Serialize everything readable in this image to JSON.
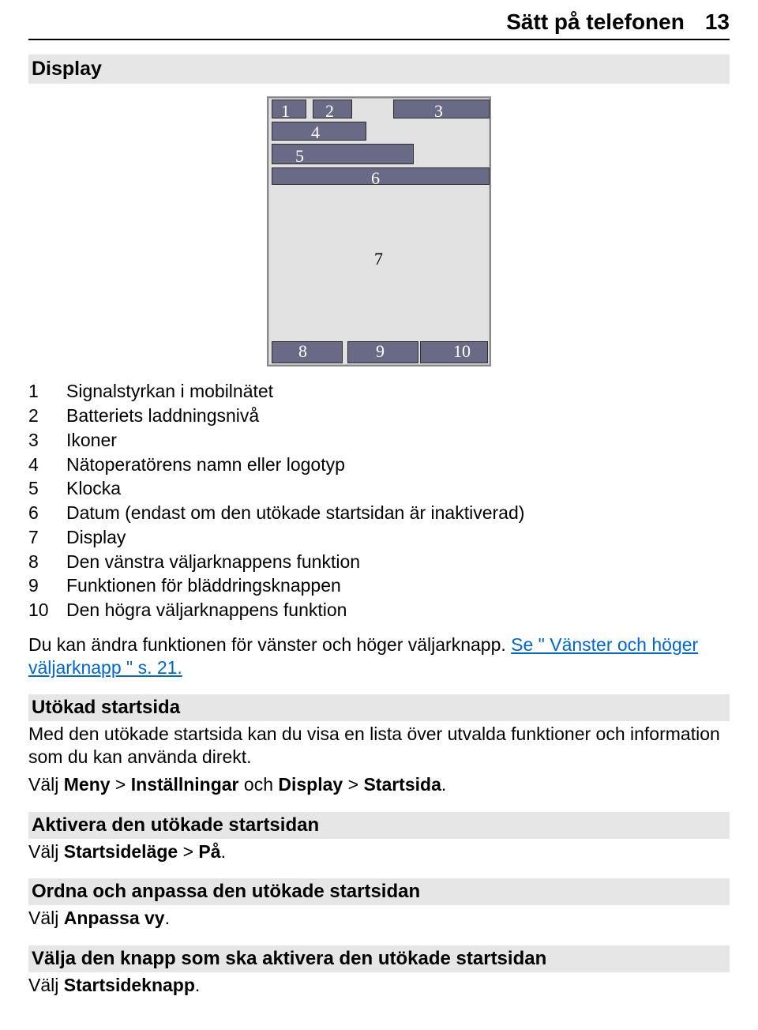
{
  "header": {
    "title": "Sätt på telefonen",
    "page_num": "13"
  },
  "section_title": "Display",
  "diagram": {
    "labels": {
      "n1": "1",
      "n2": "2",
      "n3": "3",
      "n4": "4",
      "n5": "5",
      "n6": "6",
      "n7": "7",
      "n8": "8",
      "n9": "9",
      "n10": "10"
    }
  },
  "legend": [
    {
      "n": "1",
      "t": "Signalstyrkan i mobilnätet"
    },
    {
      "n": "2",
      "t": "Batteriets laddningsnivå"
    },
    {
      "n": "3",
      "t": "Ikoner"
    },
    {
      "n": "4",
      "t": "Nätoperatörens namn eller logotyp"
    },
    {
      "n": "5",
      "t": "Klocka"
    },
    {
      "n": "6",
      "t": "Datum (endast om den utökade startsidan är inaktiverad)"
    },
    {
      "n": "7",
      "t": "Display"
    },
    {
      "n": "8",
      "t": "Den vänstra väljarknappens funktion"
    },
    {
      "n": "9",
      "t": "Funktionen för bläddringsknappen"
    },
    {
      "n": "10",
      "t": "Den högra väljarknappens funktion"
    }
  ],
  "para1_pre": "Du kan ändra funktionen för vänster och höger väljarknapp. ",
  "para1_link": "Se \" Vänster och höger väljarknapp \" s. 21.",
  "sec2": {
    "title": "Utökad startsida",
    "body": "Med den utökade startsida kan du visa en lista över utvalda funktioner och information som du kan använda direkt.",
    "nav_pre": "Välj ",
    "nav_b1": "Meny",
    "nav_mid1": " > ",
    "nav_b2": "Inställningar",
    "nav_mid2": " och ",
    "nav_b3": "Display",
    "nav_mid3": " > ",
    "nav_b4": "Startsida",
    "nav_end": "."
  },
  "sec3": {
    "title": "Aktivera den utökade startsidan",
    "pre": "Välj ",
    "b1": "Startsideläge",
    "mid": " > ",
    "b2": "På",
    "end": "."
  },
  "sec4": {
    "title": "Ordna och anpassa den utökade startsidan",
    "pre": "Välj ",
    "b1": "Anpassa vy",
    "end": "."
  },
  "sec5": {
    "title": "Välja den knapp som ska aktivera den utökade startsidan",
    "pre": "Välj ",
    "b1": "Startsideknapp",
    "end": "."
  }
}
